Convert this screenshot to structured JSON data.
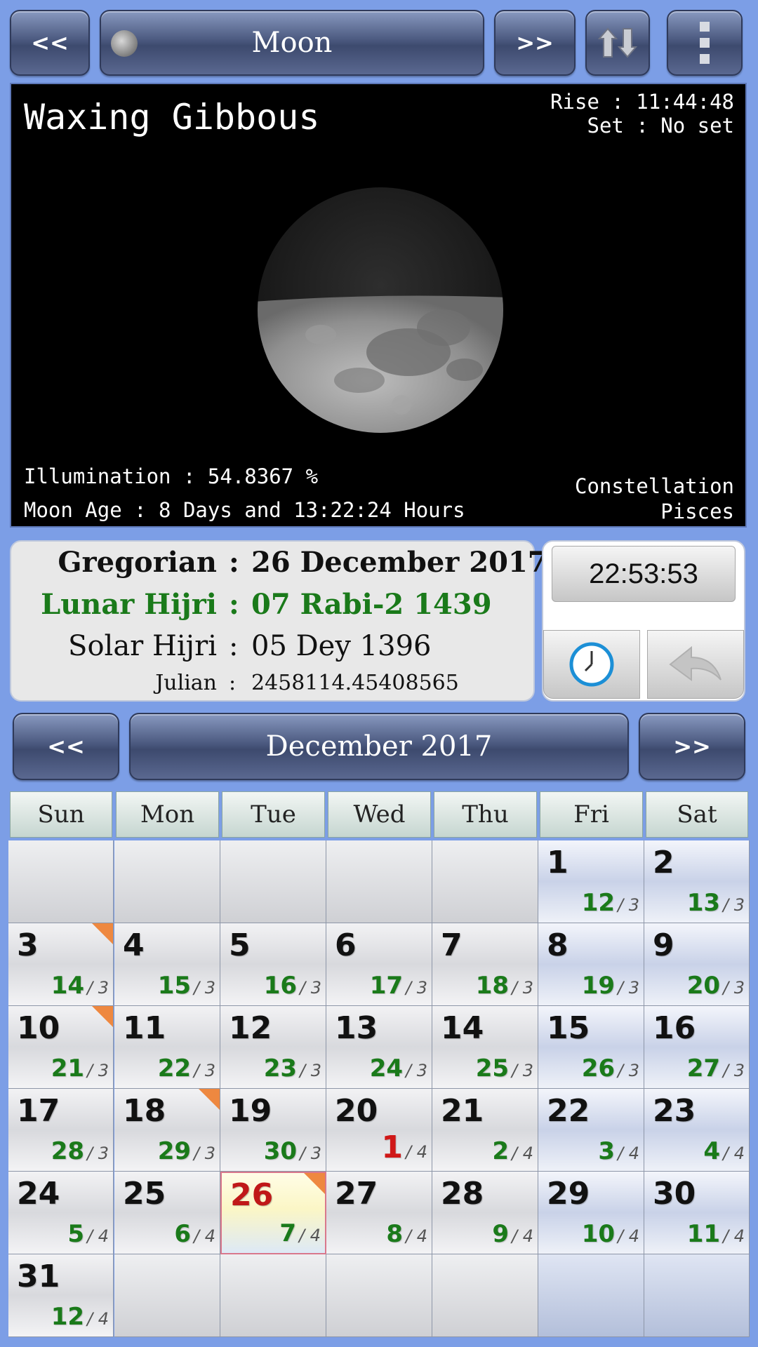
{
  "top_bar": {
    "prev_label": "<<",
    "title": "Moon",
    "next_label": ">>",
    "swap_icon": "swap-arrows-icon",
    "menu_icon": "overflow-menu-icon"
  },
  "moon": {
    "phase": "Waxing Gibbous",
    "rise": "Rise : 11:44:48",
    "set": "Set : No set",
    "illumination": "Illumination : 54.8367 %",
    "age": "Moon Age : 8 Days and 13:22:24 Hours",
    "constellation_label": "Constellation",
    "constellation": "Pisces"
  },
  "dates": {
    "gregorian_label": "Gregorian",
    "gregorian_value": "26 December 2017",
    "lunar_label": "Lunar Hijri",
    "lunar_value": "07 Rabi-2 1439",
    "solar_label": "Solar Hijri",
    "solar_value": "05 Dey 1396",
    "julian_label": "Julian",
    "julian_value": "2458114.45408565",
    "separator": ":"
  },
  "clock": {
    "time": "22:53:53",
    "clock_icon": "clock-icon",
    "back_icon": "back-arrow-icon"
  },
  "calendar": {
    "prev_label": "<<",
    "month_title": "December  2017",
    "next_label": ">>",
    "weekdays": [
      "Sun",
      "Mon",
      "Tue",
      "Wed",
      "Thu",
      "Fri",
      "Sat"
    ],
    "colors": {
      "hijri_day": "#1a7a1a",
      "new_month_day": "#d01818",
      "today": "#c01818",
      "marker": "#ee8840"
    },
    "weeks": [
      [
        null,
        null,
        null,
        null,
        null,
        {
          "d": "1",
          "h": "12",
          "m": "3"
        },
        {
          "d": "2",
          "h": "13",
          "m": "3"
        }
      ],
      [
        {
          "d": "3",
          "h": "14",
          "m": "3",
          "mark": true
        },
        {
          "d": "4",
          "h": "15",
          "m": "3"
        },
        {
          "d": "5",
          "h": "16",
          "m": "3"
        },
        {
          "d": "6",
          "h": "17",
          "m": "3"
        },
        {
          "d": "7",
          "h": "18",
          "m": "3"
        },
        {
          "d": "8",
          "h": "19",
          "m": "3"
        },
        {
          "d": "9",
          "h": "20",
          "m": "3"
        }
      ],
      [
        {
          "d": "10",
          "h": "21",
          "m": "3",
          "mark": true
        },
        {
          "d": "11",
          "h": "22",
          "m": "3"
        },
        {
          "d": "12",
          "h": "23",
          "m": "3"
        },
        {
          "d": "13",
          "h": "24",
          "m": "3"
        },
        {
          "d": "14",
          "h": "25",
          "m": "3"
        },
        {
          "d": "15",
          "h": "26",
          "m": "3"
        },
        {
          "d": "16",
          "h": "27",
          "m": "3"
        }
      ],
      [
        {
          "d": "17",
          "h": "28",
          "m": "3"
        },
        {
          "d": "18",
          "h": "29",
          "m": "3",
          "mark": true
        },
        {
          "d": "19",
          "h": "30",
          "m": "3"
        },
        {
          "d": "20",
          "h": "1",
          "m": "4",
          "red": true
        },
        {
          "d": "21",
          "h": "2",
          "m": "4"
        },
        {
          "d": "22",
          "h": "3",
          "m": "4"
        },
        {
          "d": "23",
          "h": "4",
          "m": "4"
        }
      ],
      [
        {
          "d": "24",
          "h": "5",
          "m": "4"
        },
        {
          "d": "25",
          "h": "6",
          "m": "4"
        },
        {
          "d": "26",
          "h": "7",
          "m": "4",
          "today": true,
          "mark": true
        },
        {
          "d": "27",
          "h": "8",
          "m": "4"
        },
        {
          "d": "28",
          "h": "9",
          "m": "4"
        },
        {
          "d": "29",
          "h": "10",
          "m": "4"
        },
        {
          "d": "30",
          "h": "11",
          "m": "4"
        }
      ],
      [
        {
          "d": "31",
          "h": "12",
          "m": "4"
        },
        null,
        null,
        null,
        null,
        null,
        null
      ]
    ]
  }
}
